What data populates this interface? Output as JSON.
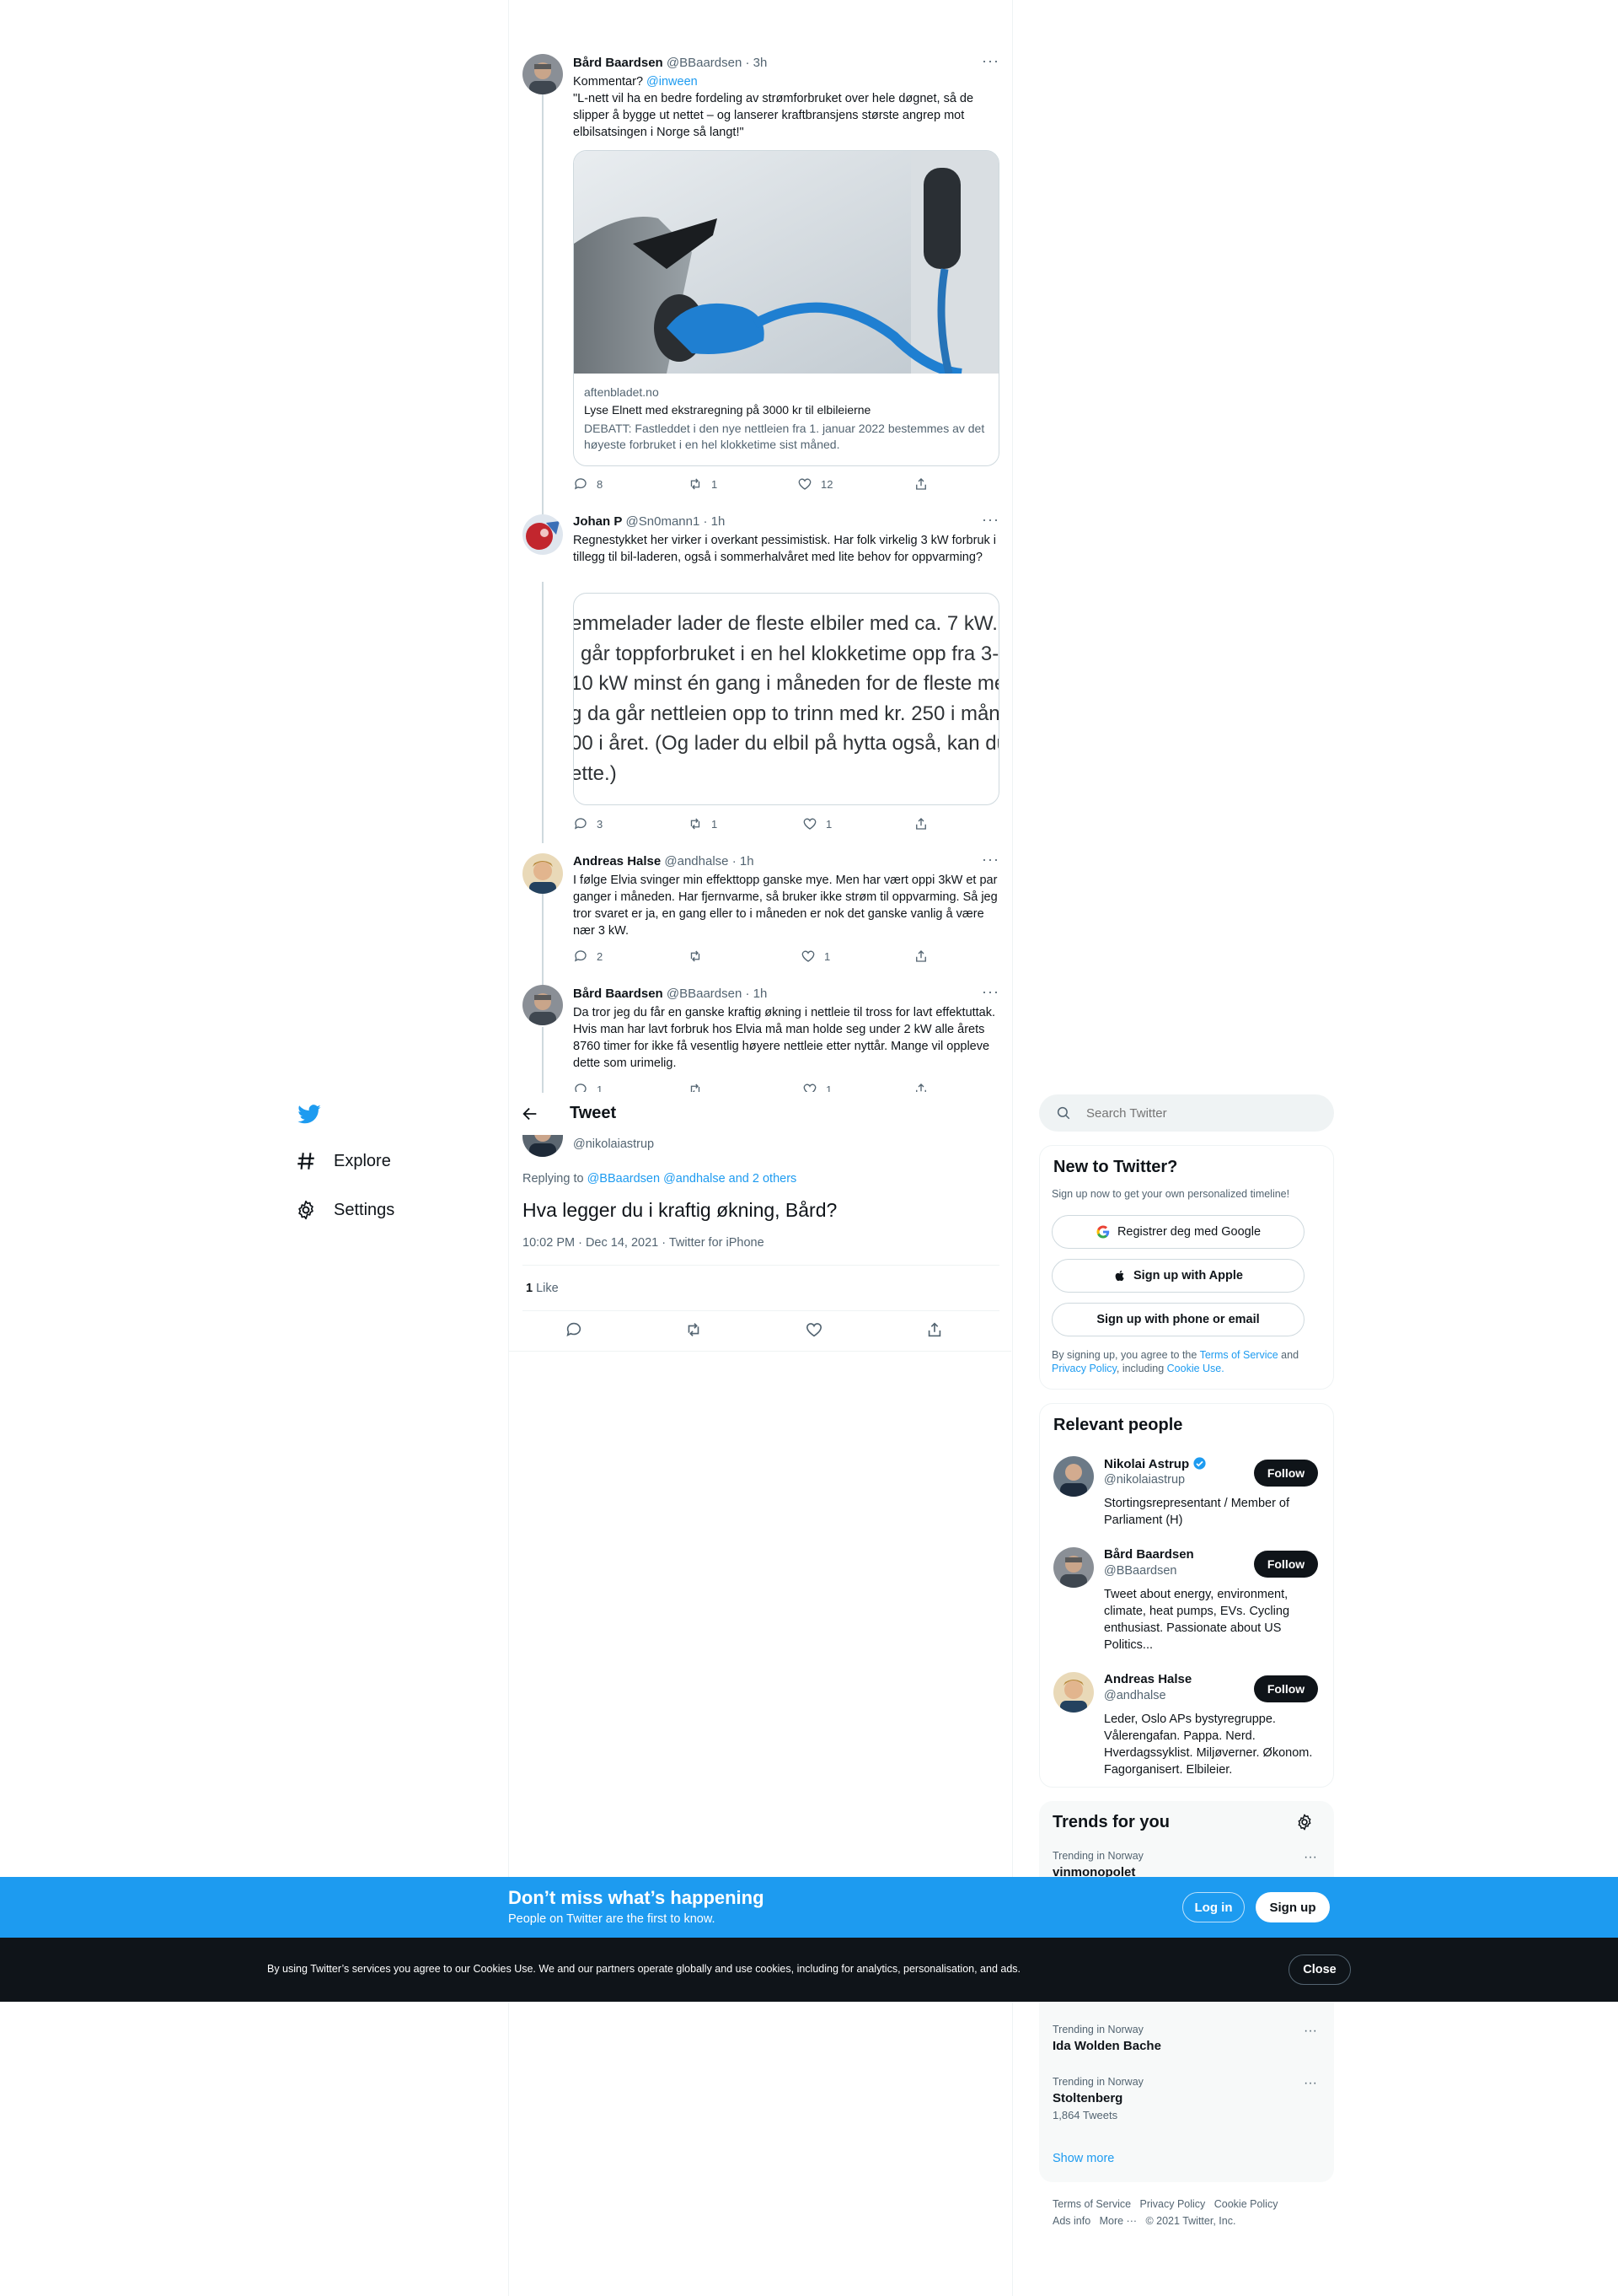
{
  "thread": {
    "tweets": [
      {
        "name": "Bård Baardsen",
        "handle": "@BBaardsen",
        "time": "· 3h",
        "text_prefix": "Kommentar? ",
        "mention": "@inween",
        "text": "\"L-nett vil ha en bedre fordeling av strømforbruket over hele døgnet, så de slipper å bygge ut nettet – og lanserer kraftbransjens største angrep mot elbilsatsingen i Norge så langt!\"",
        "card": {
          "domain": "aftenbladet.no",
          "title": "Lyse Elnett med ekstraregning på 3000 kr til elbileierne",
          "description": "DEBATT: Fastleddet i den nye nettleien fra 1. januar 2022 bestemmes av det høyeste forbruket i en hel klokketime sist måned."
        },
        "counts": {
          "replies": "8",
          "retweets": "1",
          "likes": "12"
        }
      },
      {
        "name": "Johan P",
        "handle": "@Sn0mann1",
        "time": "· 1h",
        "text": "Regnestykket her virker i overkant pessimistisk. Har folk virkelig 3 kW forbruk i tillegg til bil-laderen, også i sommerhalvåret med lite behov for oppvarming?",
        "quote_lines": [
          "emmelader lader de fleste elbiler med ca. 7 kW.",
          "l går toppforbruket i en hel klokketime opp fra 3-",
          "10 kW minst én gang i måneden for de fleste me",
          "g da går nettleien opp to trinn med kr. 250 i måne",
          "00 i året. (Og lader du elbil på hytta også, kan du",
          "ette.)"
        ],
        "counts": {
          "replies": "3",
          "retweets": "1",
          "likes": "1"
        }
      },
      {
        "name": "Andreas Halse",
        "handle": "@andhalse",
        "time": "· 1h",
        "text": "I følge Elvia svinger min effekttopp ganske mye. Men har vært oppi 3kW et par ganger i måneden. Har fjernvarme, så bruker ikke strøm til oppvarming. Så jeg tror svaret er ja, en gang eller to i måneden er nok det ganske vanlig å være nær 3 kW.",
        "counts": {
          "replies": "2",
          "retweets": "",
          "likes": "1"
        }
      },
      {
        "name": "Bård Baardsen",
        "handle": "@BBaardsen",
        "time": "· 1h",
        "text": "Da tror jeg du får en ganske kraftig økning i nettleie til tross for lavt effektuttak. Hvis man har lavt forbruk hos Elvia må man holde seg under 2 kW alle årets 8760 timer for ikke få vesentlig høyere nettleie etter nyttår. Mange vil oppleve dette som urimelig.",
        "counts": {
          "replies": "1",
          "retweets": "",
          "likes": "1"
        }
      }
    ]
  },
  "header": {
    "title": "Tweet"
  },
  "main_tweet": {
    "handle": "@nikolaiastrup",
    "replying_label": "Replying to ",
    "replying_to": "@BBaardsen @andhalse and 2 others",
    "text": "Hva legger du i kraftig økning, Bård?",
    "meta": "10:02 PM · Dec 14, 2021 · Twitter for iPhone",
    "likes_count": "1",
    "likes_label": "Like"
  },
  "nav": {
    "items": [
      {
        "label": "Explore",
        "icon": "hashtag-icon"
      },
      {
        "label": "Settings",
        "icon": "gear-icon"
      }
    ]
  },
  "search": {
    "placeholder": "Search Twitter"
  },
  "new_to_twitter": {
    "title": "New to Twitter?",
    "subtitle": "Sign up now to get your own personalized timeline!",
    "google_button": "Registrer deg med Google",
    "apple_button": "Sign up with Apple",
    "phone_button": "Sign up with phone or email",
    "legal_prefix": "By signing up, you agree to the ",
    "terms_link": "Terms of Service",
    "legal_and": " and ",
    "privacy_link": "Privacy Policy",
    "legal_including": ", including ",
    "cookie_link": "Cookie Use."
  },
  "relevant_people": {
    "title": "Relevant people",
    "follow_label": "Follow",
    "people": [
      {
        "name": "Nikolai Astrup",
        "handle": "@nikolaiastrup",
        "bio": "Stortingsrepresentant / Member of Parliament (H)",
        "verified": true
      },
      {
        "name": "Bård Baardsen",
        "handle": "@BBaardsen",
        "bio": "Tweet about energy, environment, climate, heat pumps, EVs. Cycling enthusiast. Passionate about US Politics..."
      },
      {
        "name": "Andreas Halse",
        "handle": "@andhalse",
        "bio": "Leder, Oslo APs bystyregruppe. Vålerengafan. Pappa. Nerd. Hverdagssyklist. Miljøverner. Økonom. Fagorganisert. Elbileier."
      }
    ]
  },
  "trends": {
    "title": "Trends for you",
    "items": [
      {
        "context": "Trending in Norway",
        "name": "vinmonopolet",
        "count": ""
      },
      {
        "context": "Trending in Norway",
        "name": "Ida Wolden Bache",
        "count": ""
      },
      {
        "context": "Trending in Norway",
        "name": "Stoltenberg",
        "count": "1,864 Tweets"
      }
    ],
    "show_more": "Show more"
  },
  "footer": {
    "terms": "Terms of Service",
    "privacy": "Privacy Policy",
    "cookie": "Cookie Policy",
    "ads": "Ads info",
    "more": "More ···",
    "copyright": "© 2021 Twitter, Inc."
  },
  "banner": {
    "title": "Don’t miss what’s happening",
    "subtitle": "People on Twitter are the first to know.",
    "login": "Log in",
    "signup": "Sign up"
  },
  "cookie_bar": {
    "text": "By using Twitter’s services you agree to our Cookies Use. We and our partners operate globally and use cookies, including for analytics, personalisation, and ads.",
    "close": "Close"
  },
  "colors": {
    "accent": "#1d9bf0",
    "dark": "#0f1419",
    "muted": "#536471",
    "border": "#eff3f4"
  }
}
